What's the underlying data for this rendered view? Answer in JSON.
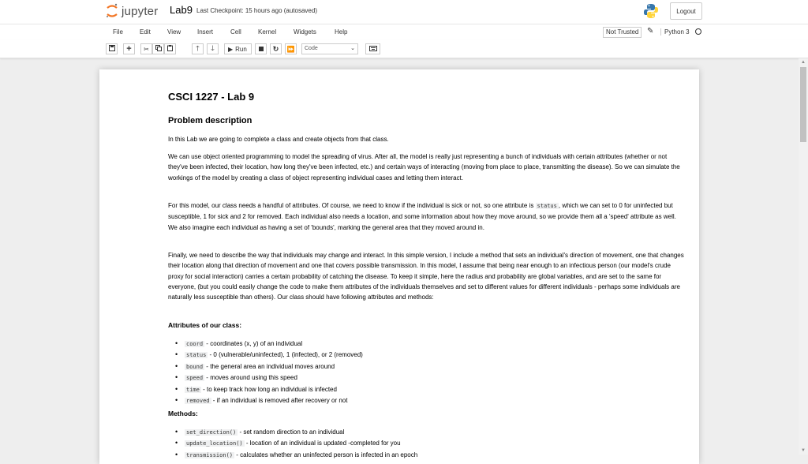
{
  "header": {
    "logo_text": "jupyter",
    "notebook_title": "Lab9",
    "checkpoint": "Last Checkpoint: 15 hours ago  (autosaved)",
    "logout_label": "Logout"
  },
  "menubar": {
    "items": [
      "File",
      "Edit",
      "View",
      "Insert",
      "Cell",
      "Kernel",
      "Widgets",
      "Help"
    ],
    "trust_label": "Not Trusted",
    "kernel_name": "Python 3"
  },
  "toolbar": {
    "run_label": "Run",
    "cell_type": "Code",
    "icons": [
      "save-icon",
      "plus-icon",
      "cut-icon",
      "copy-icon",
      "paste-icon",
      "arrow-up-icon",
      "arrow-down-icon",
      "run-icon",
      "stop-icon",
      "restart-icon",
      "fast-forward-icon",
      "keyboard-icon"
    ]
  },
  "notebook": {
    "title": "CSCI 1227 - Lab 9",
    "section": "Problem description",
    "intro": "In this Lab we are going to complete a class and create objects from that class.",
    "para1": "We can use object oriented programming to model the spreading of virus. After all, the model is really just representing a bunch of individuals with certain attributes (whether or not they've been infected, their location, how long they've been infected, etc.) and certain ways of interacting (moving from place to place, transmitting the disease). So we can simulate the workings of the model by creating a class of object representing individual cases and letting them interact.",
    "para2_a": "For this model, our class needs a handful of attributes. Of course, we need to know if the individual is sick or not, so one attribute is ",
    "para2_code": "status",
    "para2_b": ", which we can set to 0 for uninfected but susceptible, 1 for sick and 2 for removed. Each individual also needs a location, and some information about how they move around, so we provide them all a 'speed' attribute as well. We also imagine each individual as having a set of 'bounds', marking the general area that they moved around in.",
    "para3": "Finally, we need to describe the way that individuals may change and interact. In this simple version, I include a method that sets an individual's direction of movement, one that changes their location along that direction of movement and one that covers possible transmission. In this model, I assume that being near enough to an infectious person (our model's crude proxy for social interaction) carries a certain probability of catching the disease. To keep it simple, here the radius and probability are global variables, and are set to the same for everyone, (but you could easily change the code to make them attributes of the individuals themselves and set to different values for different individuals - perhaps some individuals are naturally less susceptible than others). Our class should have following attributes and methods:",
    "attrs_heading": "Attributes of our class:",
    "attributes": [
      {
        "code": "coord",
        "desc": " - coordinates (x, y) of an individual"
      },
      {
        "code": "status",
        "desc": " - 0 (vulnerable/uninfected), 1 (infected), or 2 (removed)"
      },
      {
        "code": "bound",
        "desc": " - the general area an individual moves around"
      },
      {
        "code": "speed",
        "desc": " - moves around using this speed"
      },
      {
        "code": "time",
        "desc": " - to keep track how long an individual is infected"
      },
      {
        "code": "removed",
        "desc": " - if an individual is removed after recovery or not"
      }
    ],
    "methods_heading": "Methods:",
    "methods": [
      {
        "code": "set_direction()",
        "desc": " - set random direction to an individual"
      },
      {
        "code": "update_location()",
        "desc": " - location of an individual is updated -completed for you"
      },
      {
        "code": "transmission()",
        "desc": " - calculates whether an uninfected person is infected in an epoch"
      }
    ]
  }
}
